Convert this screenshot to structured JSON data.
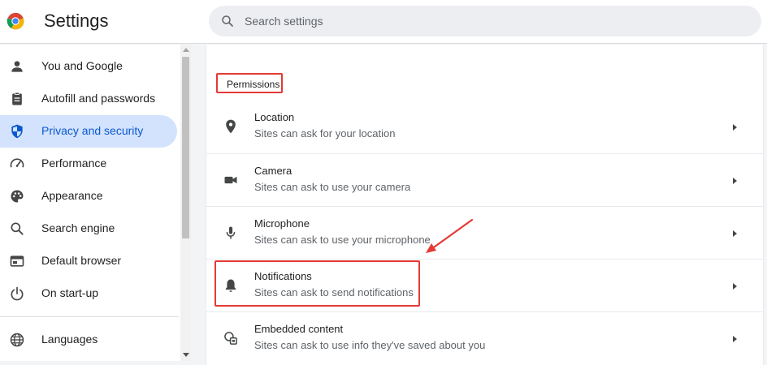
{
  "header": {
    "title": "Settings",
    "search_placeholder": "Search settings",
    "search_value": ""
  },
  "sidebar": {
    "items": [
      {
        "label": "You and Google",
        "icon": "person-icon",
        "active": false
      },
      {
        "label": "Autofill and passwords",
        "icon": "clipboard-icon",
        "active": false
      },
      {
        "label": "Privacy and security",
        "icon": "shield-icon",
        "active": true
      },
      {
        "label": "Performance",
        "icon": "speedometer-icon",
        "active": false
      },
      {
        "label": "Appearance",
        "icon": "palette-icon",
        "active": false
      },
      {
        "label": "Search engine",
        "icon": "search-icon",
        "active": false
      },
      {
        "label": "Default browser",
        "icon": "browser-window-icon",
        "active": false
      },
      {
        "label": "On start-up",
        "icon": "power-icon",
        "active": false
      },
      {
        "label": "Languages",
        "icon": "globe-icon",
        "active": false
      }
    ]
  },
  "main": {
    "section_title": "Permissions",
    "permissions": [
      {
        "title": "Location",
        "description": "Sites can ask for your location",
        "icon": "location-pin-icon"
      },
      {
        "title": "Camera",
        "description": "Sites can ask to use your camera",
        "icon": "camera-icon"
      },
      {
        "title": "Microphone",
        "description": "Sites can ask to use your microphone",
        "icon": "microphone-icon"
      },
      {
        "title": "Notifications",
        "description": "Sites can ask to send notifications",
        "icon": "bell-icon"
      },
      {
        "title": "Embedded content",
        "description": "Sites can ask to use info they've saved about you",
        "icon": "embedded-content-icon"
      }
    ]
  },
  "colors": {
    "accent": "#0b57d0",
    "active_nav_bg": "#d3e3fd",
    "annotation_red": "#e53935"
  }
}
